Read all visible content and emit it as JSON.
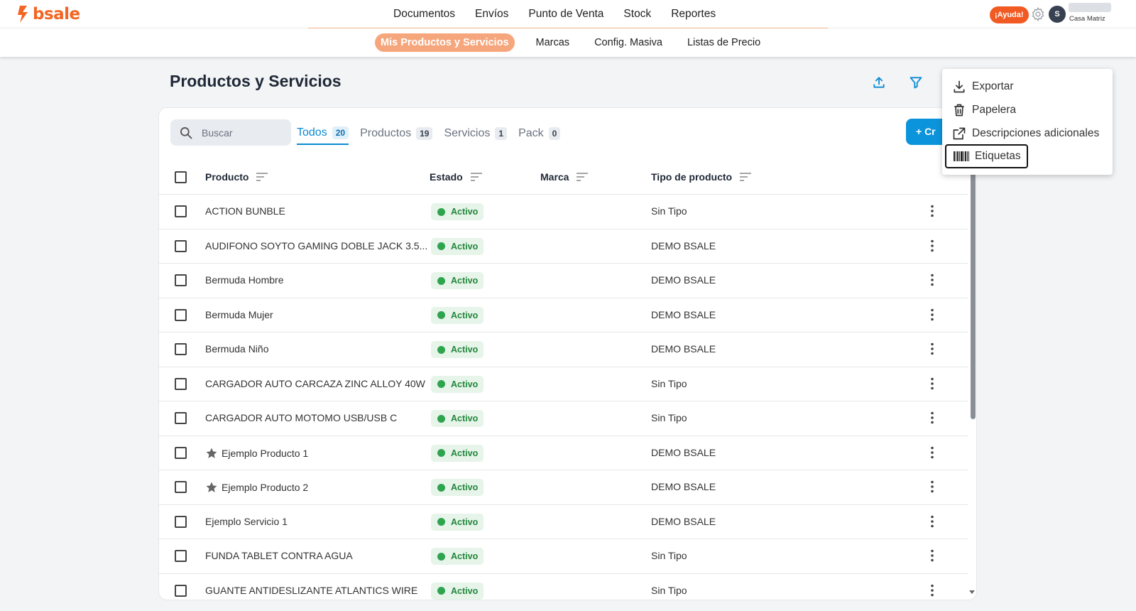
{
  "brand": {
    "name": "bsale",
    "color": "#f26522"
  },
  "topnav": {
    "items": [
      "Documentos",
      "Envíos",
      "Punto de Venta",
      "Stock",
      "Reportes"
    ]
  },
  "header": {
    "help_label": "¡Ayuda!",
    "avatar_initial": "S",
    "branch": "Casa Matriz"
  },
  "subnav": {
    "items": [
      "Mis Productos y Servicios",
      "Marcas",
      "Config. Masiva",
      "Listas de Precio"
    ],
    "active": 0
  },
  "page": {
    "title": "Productos y Servicios"
  },
  "search": {
    "placeholder": "Buscar"
  },
  "tabs": [
    {
      "label": "Todos",
      "count": "20"
    },
    {
      "label": "Productos",
      "count": "19"
    },
    {
      "label": "Servicios",
      "count": "1"
    },
    {
      "label": "Pack",
      "count": "0"
    }
  ],
  "create_button": {
    "label": "+  Cr"
  },
  "table": {
    "columns": [
      "Producto",
      "Estado",
      "Marca",
      "Tipo de producto"
    ],
    "rows": [
      {
        "name": "ACTION BUNBLE",
        "status": "Activo",
        "brand": "",
        "type": "Sin Tipo",
        "starred": false
      },
      {
        "name": "AUDIFONO SOYTO GAMING DOBLE JACK 3.5...",
        "status": "Activo",
        "brand": "",
        "type": "DEMO BSALE",
        "starred": false
      },
      {
        "name": "Bermuda Hombre",
        "status": "Activo",
        "brand": "",
        "type": "DEMO BSALE",
        "starred": false
      },
      {
        "name": "Bermuda Mujer",
        "status": "Activo",
        "brand": "",
        "type": "DEMO BSALE",
        "starred": false
      },
      {
        "name": "Bermuda Niño",
        "status": "Activo",
        "brand": "",
        "type": "DEMO BSALE",
        "starred": false
      },
      {
        "name": "CARGADOR AUTO CARCAZA ZINC ALLOY 40W",
        "status": "Activo",
        "brand": "",
        "type": "Sin Tipo",
        "starred": false
      },
      {
        "name": "CARGADOR AUTO MOTOMO USB/USB C",
        "status": "Activo",
        "brand": "",
        "type": "Sin Tipo",
        "starred": false
      },
      {
        "name": "Ejemplo Producto 1",
        "status": "Activo",
        "brand": "",
        "type": "DEMO BSALE",
        "starred": true
      },
      {
        "name": "Ejemplo Producto 2",
        "status": "Activo",
        "brand": "",
        "type": "DEMO BSALE",
        "starred": true
      },
      {
        "name": "Ejemplo Servicio 1",
        "status": "Activo",
        "brand": "",
        "type": "DEMO BSALE",
        "starred": false
      },
      {
        "name": "FUNDA TABLET CONTRA AGUA",
        "status": "Activo",
        "brand": "",
        "type": "Sin Tipo",
        "starred": false
      },
      {
        "name": "GUANTE ANTIDESLIZANTE ATLANTICS WIRE",
        "status": "Activo",
        "brand": "",
        "type": "Sin Tipo",
        "starred": false
      }
    ]
  },
  "menu": {
    "items": [
      {
        "label": "Exportar",
        "icon": "download-icon"
      },
      {
        "label": "Papelera",
        "icon": "trash-icon"
      },
      {
        "label": "Descripciones adicionales",
        "icon": "external-link-icon"
      },
      {
        "label": "Etiquetas",
        "icon": "barcode-icon",
        "focused": true
      }
    ]
  },
  "colors": {
    "accent_blue": "#0b94db",
    "active_green": "#2ea44f",
    "subnav_active": "#f6a67c",
    "help_orange": "#f15a22"
  }
}
